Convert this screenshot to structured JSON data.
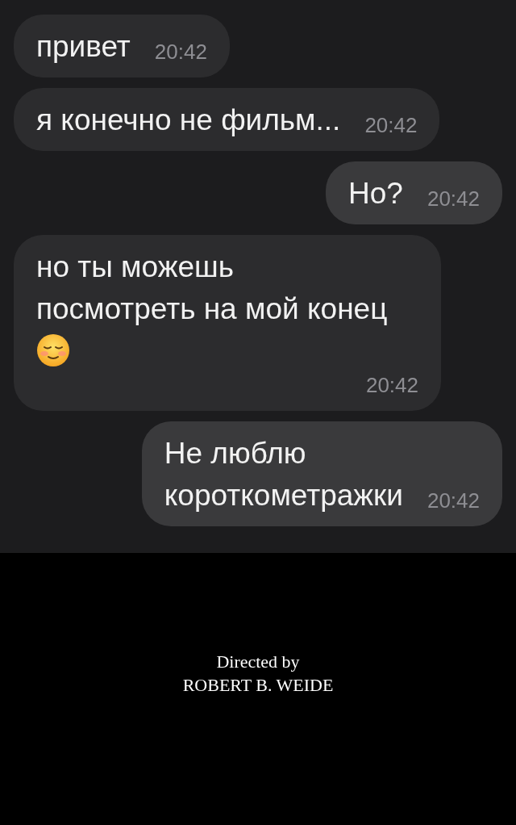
{
  "messages": [
    {
      "kind": "incoming",
      "lines": [
        "привет"
      ],
      "emoji": false,
      "time": "20:42"
    },
    {
      "kind": "incoming",
      "lines": [
        "я конечно не фильм..."
      ],
      "emoji": false,
      "time": "20:42"
    },
    {
      "kind": "outgoing",
      "lines": [
        "Но?"
      ],
      "emoji": false,
      "time": "20:42"
    },
    {
      "kind": "incoming",
      "lines": [
        "но ты можешь",
        "посмотреть на мой конец"
      ],
      "emoji": true,
      "time": "20:42"
    },
    {
      "kind": "outgoing",
      "lines": [
        "Не люблю",
        "короткометражки"
      ],
      "emoji": false,
      "time": "20:42"
    }
  ],
  "credits": {
    "line_1": "Directed by",
    "line_2": "ROBERT B. WEIDE"
  }
}
